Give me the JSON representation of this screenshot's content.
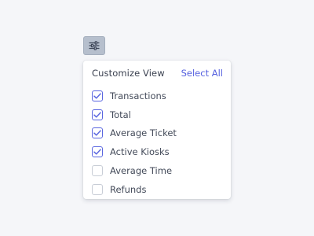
{
  "filter_button": {
    "icon": "sliders-icon",
    "colors": {
      "background": "#b6bfcd",
      "icon": "#3e4658"
    }
  },
  "panel": {
    "title": "Customize View",
    "select_all_label": "Select All",
    "accent_color": "#5a66e0",
    "options": [
      {
        "label": "Transactions",
        "checked": true
      },
      {
        "label": "Total",
        "checked": true
      },
      {
        "label": "Average Ticket",
        "checked": true
      },
      {
        "label": "Active Kiosks",
        "checked": true
      },
      {
        "label": "Average Time",
        "checked": false
      },
      {
        "label": "Refunds",
        "checked": false
      }
    ]
  }
}
